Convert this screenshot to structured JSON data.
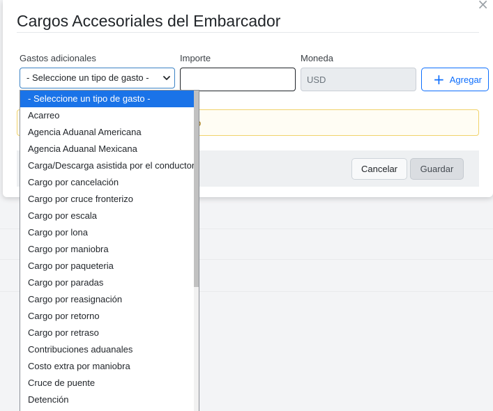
{
  "modal": {
    "title": "Cargos Accesoriales del Embarcador",
    "close_glyph": "×"
  },
  "form": {
    "gastos_label": "Gastos adicionales",
    "importe_label": "Importe",
    "moneda_label": "Moneda",
    "select_value": "- Seleccione un tipo de gasto -",
    "importe_value": "",
    "moneda_value": "USD",
    "add_button_label": "Agregar"
  },
  "alert": {
    "visible_text": "o"
  },
  "footer": {
    "cancel_label": "Cancelar",
    "save_label": "Guardar"
  },
  "dropdown": {
    "items": [
      "- Seleccione un tipo de gasto -",
      "Acarreo",
      "Agencia Aduanal Americana",
      "Agencia Aduanal Mexicana",
      "Carga/Descarga asistida por el conductor",
      "Cargo por cancelación",
      "Cargo por cruce fronterizo",
      "Cargo por escala",
      "Cargo por lona",
      "Cargo por maniobra",
      "Cargo por paqueteria",
      "Cargo por paradas",
      "Cargo por reasignación",
      "Cargo por retorno",
      "Cargo por retraso",
      "Contribuciones aduanales",
      "Costo extra por maniobra",
      "Cruce de puente",
      "Detención"
    ],
    "selected_index": 0
  },
  "icons": {
    "close": "close-icon",
    "chevron": "chevron-down-icon",
    "plus": "plus-icon"
  },
  "colors": {
    "accent": "#0d6efd",
    "selected_bg": "#1a73e8",
    "alert_border": "#f1d36b"
  }
}
